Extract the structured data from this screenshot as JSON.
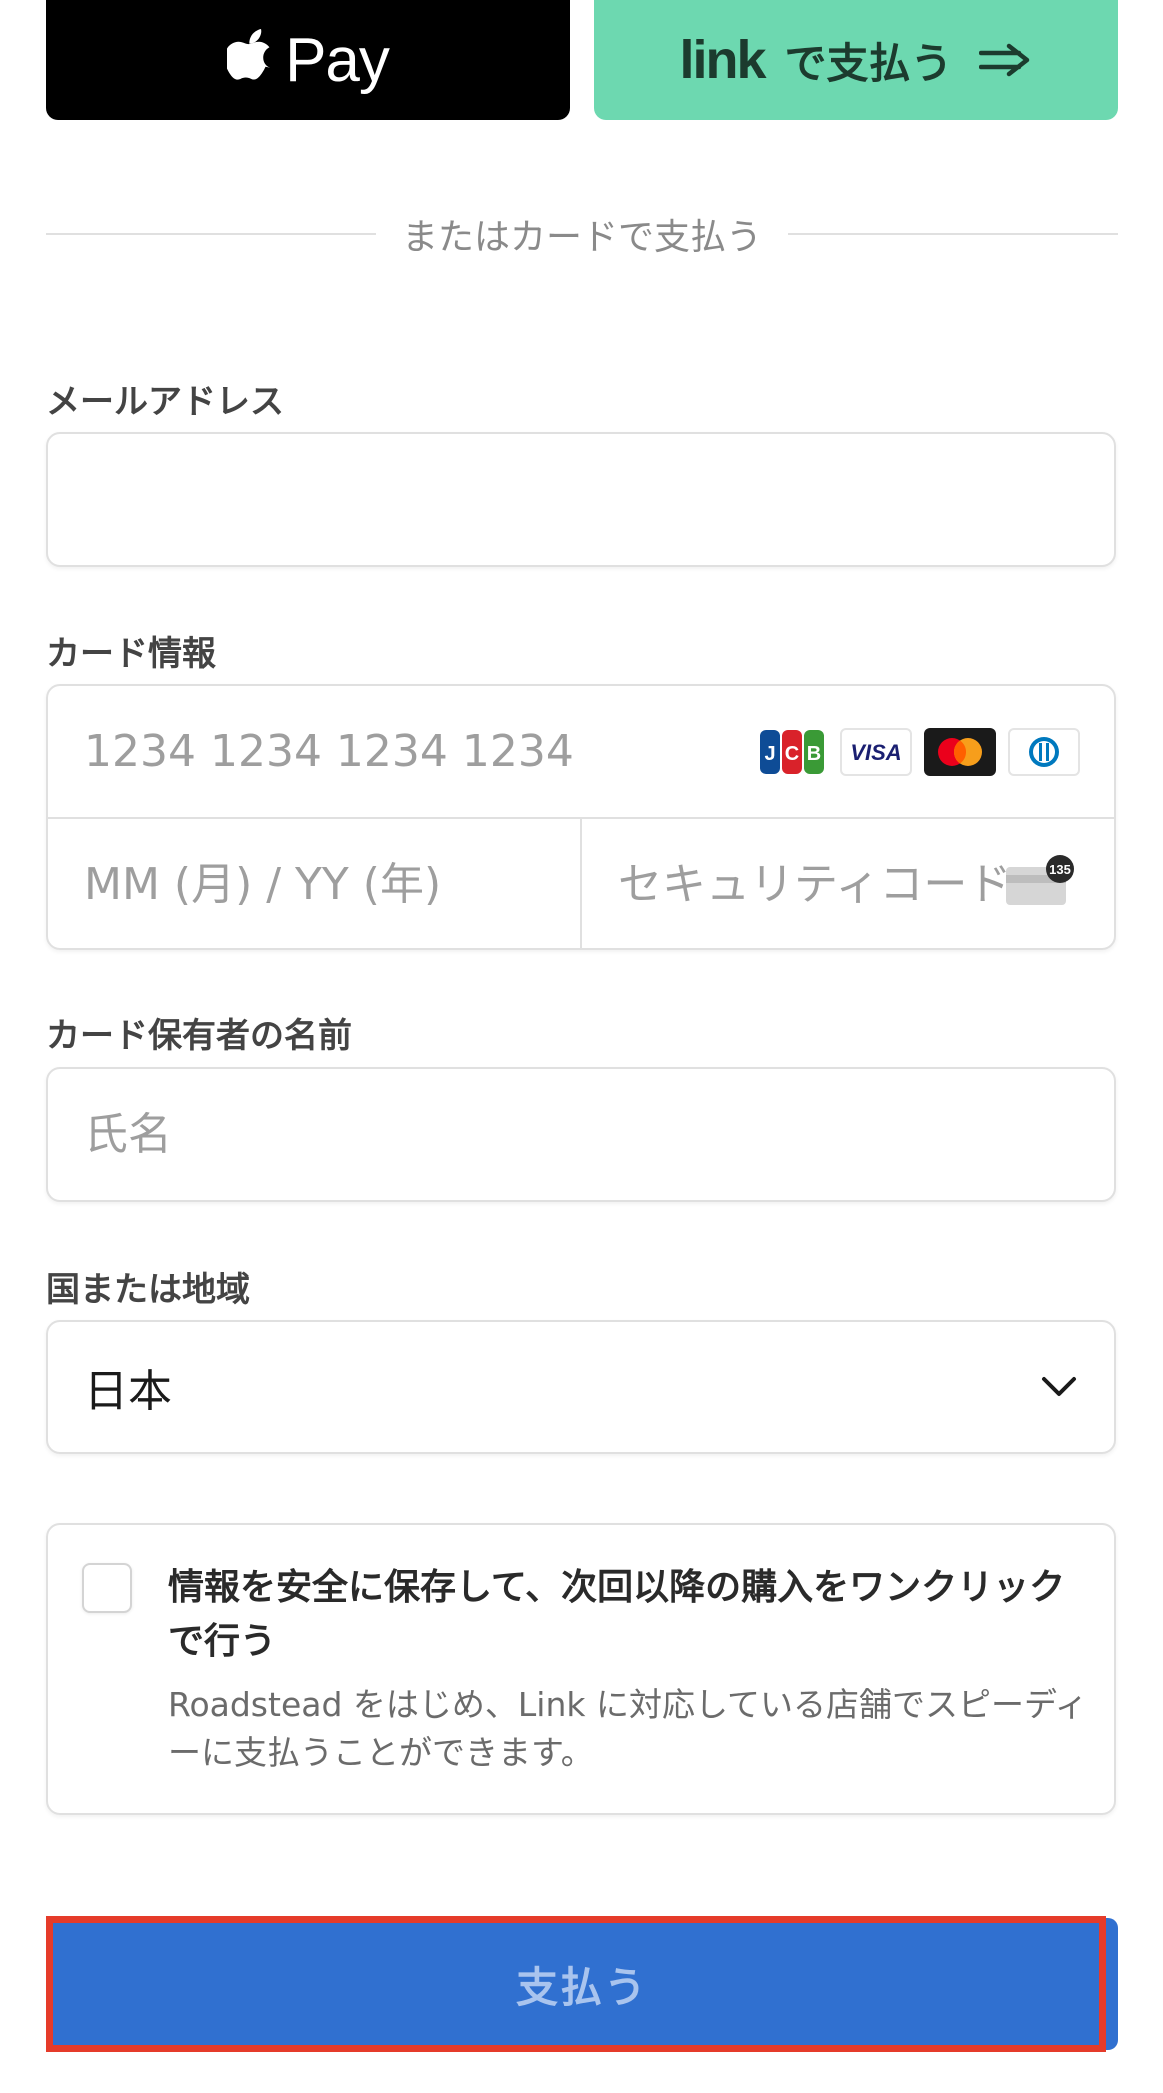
{
  "wallets": {
    "apple_pay_label": "Pay",
    "link_brand": "link",
    "link_label": "で支払う"
  },
  "divider": {
    "label": "またはカードで支払う"
  },
  "email": {
    "label": "メールアドレス",
    "value": "",
    "placeholder": ""
  },
  "card": {
    "label": "カード情報",
    "number_placeholder": "1234 1234 1234 1234",
    "expiry_placeholder": "MM (月) / YY (年)",
    "cvc_placeholder": "セキュリティコード",
    "cvc_icon_text": "135",
    "brands": [
      "jcb-icon",
      "visa-icon",
      "mastercard-icon",
      "diners-icon"
    ]
  },
  "cardholder": {
    "label": "カード保有者の名前",
    "placeholder": "氏名"
  },
  "country": {
    "label": "国または地域",
    "value": "日本"
  },
  "save_info": {
    "title": "情報を安全に保存して、次回以降の購入をワンクリックで行う",
    "description": "Roadstead をはじめ、Link に対応している店舗でスピーディーに支払うことができます。",
    "checked": false
  },
  "submit": {
    "label": "支払う"
  },
  "colors": {
    "apple_pay_bg": "#000000",
    "link_bg": "#6dd8b0",
    "pay_button_bg": "#3070d0",
    "highlight": "#e53b2a"
  }
}
